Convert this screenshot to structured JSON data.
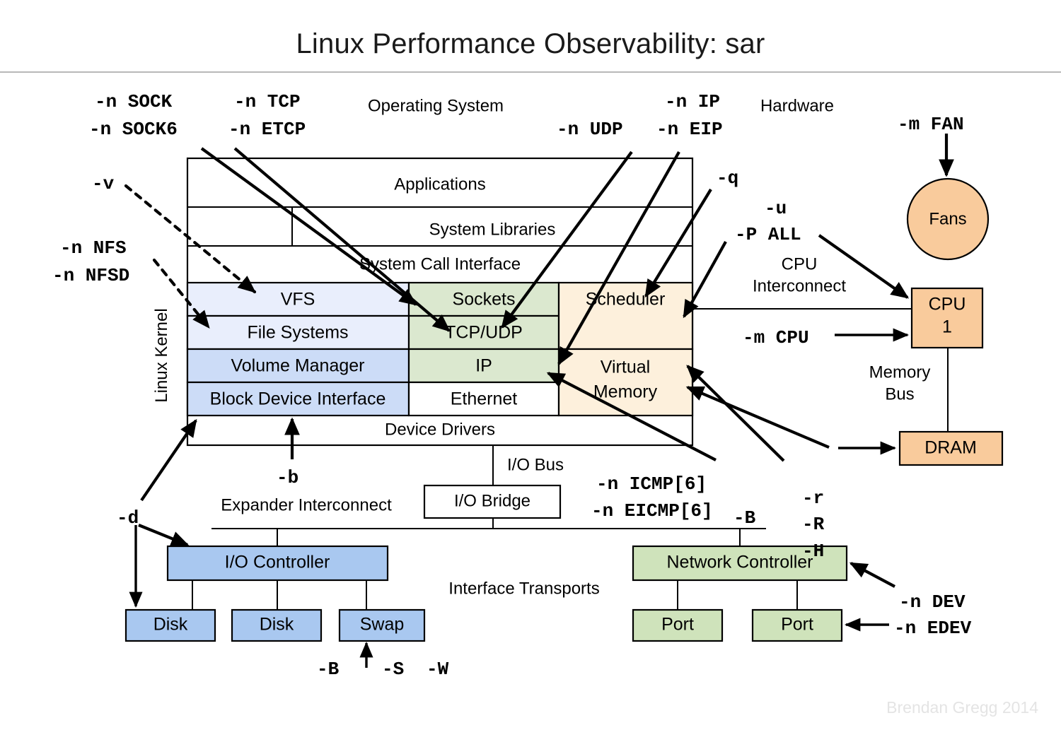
{
  "title": "Linux Performance Observability: sar",
  "credit": "Brendan Gregg 2014",
  "colors": {
    "blue_light": "#e9eefc",
    "blue_mid": "#ccdcf7",
    "blue_strong": "#a9c8f0",
    "green_light": "#dbe8cf",
    "green_strong": "#cfe3bb",
    "orange_light": "#fdf0dc",
    "orange_strong": "#f9cb9c",
    "white": "#ffffff",
    "stroke": "#000000",
    "credit": "#e4e4e4",
    "rule": "#b8b8b8"
  },
  "region_labels": {
    "operating_system": "Operating System",
    "hardware": "Hardware",
    "linux_kernel": "Linux Kernel",
    "cpu_interconnect": "CPU\nInterconnect",
    "cpu_interconnect_l1": "CPU",
    "cpu_interconnect_l2": "Interconnect",
    "memory_bus_l1": "Memory",
    "memory_bus_l2": "Bus",
    "io_bus": "I/O Bus",
    "expander_interconnect": "Expander Interconnect",
    "interface_transports": "Interface Transports"
  },
  "os_stack": {
    "applications": "Applications",
    "system_libraries": "System Libraries",
    "system_call_interface": "System Call Interface",
    "device_drivers": "Device Drivers"
  },
  "kernel_grid": {
    "storage_column": [
      "VFS",
      "File Systems",
      "Volume Manager",
      "Block Device Interface"
    ],
    "network_column": [
      "Sockets",
      "TCP/UDP",
      "IP",
      "Ethernet"
    ],
    "cpu_mem_column": [
      "Scheduler",
      "Virtual Memory"
    ]
  },
  "hardware": {
    "fans": "Fans",
    "cpu": "CPU\n1",
    "cpu_l1": "CPU",
    "cpu_l2": "1",
    "dram": "DRAM",
    "io_bridge": "I/O Bridge",
    "io_controller": "I/O Controller",
    "network_controller": "Network Controller",
    "disk1": "Disk",
    "disk2": "Disk",
    "swap": "Swap",
    "port1": "Port",
    "port2": "Port"
  },
  "sar_options": {
    "sock": "-n SOCK",
    "sock6": "-n SOCK6",
    "tcp": "-n TCP",
    "etcp": "-n ETCP",
    "ip": "-n IP",
    "udp": "-n UDP",
    "eip": "-n EIP",
    "q": "-q",
    "u": "-u",
    "p_all": "-P ALL",
    "m_fan": "-m FAN",
    "m_cpu": "-m CPU",
    "v": "-v",
    "n_nfs": "-n NFS",
    "n_nfsd": "-n NFSD",
    "b_lower": "-b",
    "d": "-d",
    "B_upper": "-B",
    "r": "-r",
    "R": "-R",
    "H": "-H",
    "icmp": "-n ICMP[6]",
    "eicmp": "-n EICMP[6]",
    "n_dev": "-n DEV",
    "n_edev": "-n EDEV",
    "swap_B": "-B",
    "swap_S": "-S",
    "swap_W": "-W"
  }
}
